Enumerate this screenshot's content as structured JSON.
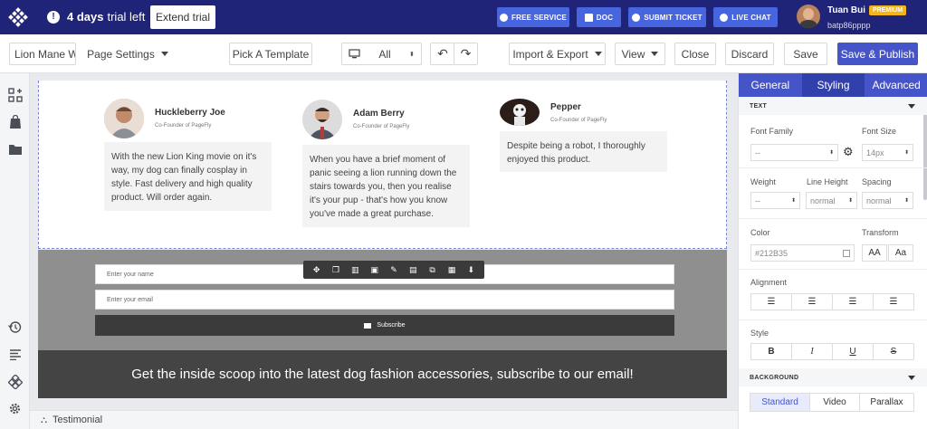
{
  "topbar": {
    "trial_days": "4 days",
    "trial_suffix": "trial left",
    "extend_label": "Extend trial",
    "buttons": {
      "free_service": "FREE SERVICE",
      "doc": "DOC",
      "submit_ticket": "SUBMIT TICKET",
      "live_chat": "LIVE CHAT"
    },
    "user": {
      "name": "Tuan Bui",
      "badge": "PREMIUM",
      "email": "batp86pppp"
    }
  },
  "toolbar": {
    "page_name": "Lion Mane W",
    "page_settings": "Page Settings",
    "pick_template": "Pick A Template",
    "device_value": "All",
    "import_export": "Import & Export",
    "view": "View",
    "close": "Close",
    "discard": "Discard",
    "save": "Save",
    "save_publish": "Save & Publish"
  },
  "testimonials": [
    {
      "name": "Huckleberry Joe",
      "role": "Co-Founder of PageFly",
      "quote": "With the new Lion King movie on it's way, my dog can finally cosplay in style. Fast delivery and high quality product. Will order again."
    },
    {
      "name": "Adam Berry",
      "role": "Co-Founder of PageFly",
      "quote": "When you have a brief moment of panic seeing a lion running down the stairs towards you, then you realise it's your pup - that's how you know you've made a great purchase."
    },
    {
      "name": "Pepper",
      "role": "Co-Founder of PageFly",
      "quote": "Despite being a robot, I thoroughly enjoyed this product."
    }
  ],
  "form": {
    "name_placeholder": "Enter your name",
    "email_placeholder": "Enter your email",
    "subscribe_label": "Subscribe"
  },
  "banner": {
    "text": "Get the inside scoop into the latest dog fashion accessories, subscribe to our email!"
  },
  "breadcrumb": {
    "label": "Testimonial"
  },
  "panel": {
    "tabs": [
      "General",
      "Styling",
      "Advanced"
    ],
    "active_tab": "Styling",
    "text_section": "TEXT",
    "font_family_label": "Font Family",
    "font_family_value": "--",
    "font_size_label": "Font Size",
    "font_size_value": "14px",
    "weight_label": "Weight",
    "weight_value": "--",
    "line_height_label": "Line Height",
    "line_height_value": "normal",
    "spacing_label": "Spacing",
    "spacing_value": "normal",
    "color_label": "Color",
    "color_value": "#212B35",
    "transform_label": "Transform",
    "transform_options": [
      "AA",
      "Aa"
    ],
    "alignment_label": "Alignment",
    "style_label": "Style",
    "style_options": [
      "B",
      "I",
      "U",
      "S"
    ],
    "background_section": "BACKGROUND",
    "background_options": [
      "Standard",
      "Video",
      "Parallax"
    ],
    "background_active": "Standard"
  },
  "colors": {
    "topbar": "#1f2478",
    "accent": "#4554c9",
    "button_blue": "#4865e0",
    "premium": "#f4b41a"
  }
}
